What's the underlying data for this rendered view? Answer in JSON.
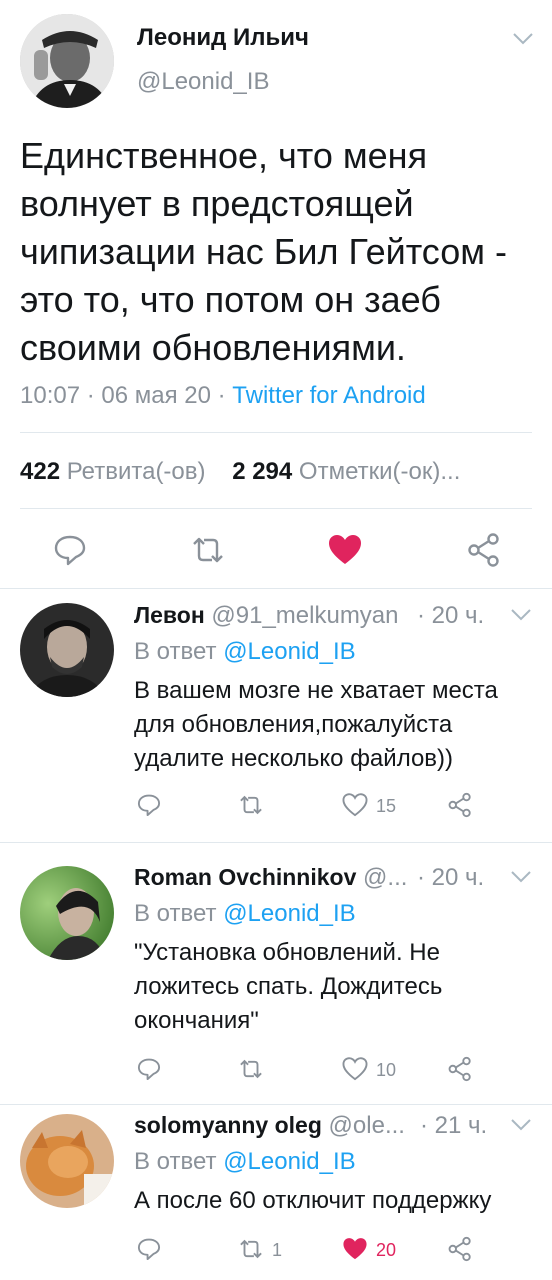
{
  "tweet": {
    "author_name": "Леонид Ильич",
    "author_handle": "@Leonid_IB",
    "text": "Единственное, что меня волнует в предстоящей чипизации нас Бил Гейтсом - это то, что потом он заеб своими обновлениями.",
    "time": "10:07 · 06 мая 20 · ",
    "source": "Twitter for Android",
    "retweets_count": "422",
    "retweets_label": "Ретвита(-ов)",
    "likes_count": "2 294",
    "likes_label": "Отметки(-ок)...",
    "liked": true,
    "colors": {
      "like": "#e0245e",
      "link": "#1da1f2",
      "muted": "#8a9199"
    },
    "actions": [
      "reply-icon",
      "retweet-icon",
      "like-icon",
      "share-icon"
    ]
  },
  "replies": [
    {
      "name": "Левон",
      "handle": "@91_melkumyan",
      "time": "· 20 ч.",
      "in_reply_prefix": "В ответ",
      "in_reply_to": "@Leonid_IB",
      "text": "В вашем мозге не хватает места для обновления,пожалуйста удалите несколько файлов))",
      "retweets": "",
      "likes": "15",
      "liked": false
    },
    {
      "name": "Roman Ovchinnikov",
      "handle": "@...",
      "time": "· 20 ч.",
      "in_reply_prefix": "В ответ",
      "in_reply_to": "@Leonid_IB",
      "text": "\"Установка обновлений. Не ложитесь спать. Дождитесь окончания\"",
      "retweets": "",
      "likes": "10",
      "liked": false
    },
    {
      "name": "solomyanny oleg",
      "handle": "@ole...",
      "time": "· 21 ч.",
      "in_reply_prefix": "В ответ",
      "in_reply_to": "@Leonid_IB",
      "text": "А после 60 отключит поддержку",
      "retweets": "1",
      "likes": "20",
      "liked": true
    }
  ]
}
